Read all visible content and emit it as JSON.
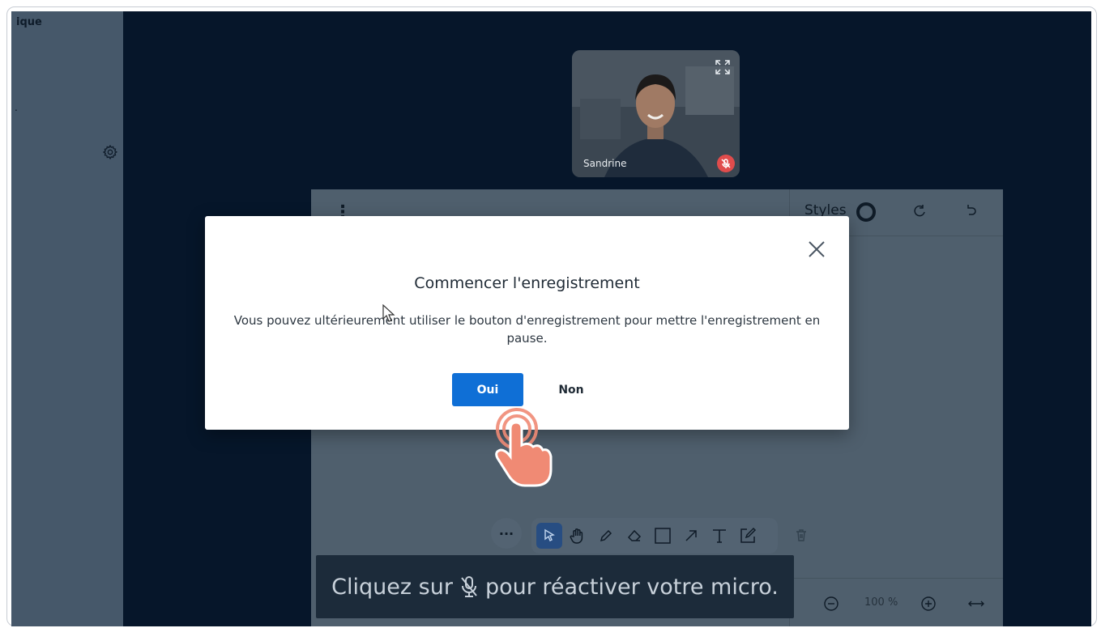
{
  "sidebar": {
    "top_text": "ique",
    "dot": "."
  },
  "video": {
    "participant_name": "Sandrine",
    "expand_icon": "expand-icon",
    "mute_icon": "mic-off-icon"
  },
  "board": {
    "styles_label": "Styles",
    "zoom_level": "100 %",
    "more_label": "···",
    "tools": [
      "select-icon",
      "hand-icon",
      "pencil-icon",
      "eraser-icon",
      "rectangle-icon",
      "arrow-icon",
      "text-icon",
      "note-icon"
    ]
  },
  "mic_notice": {
    "before": "Cliquez sur",
    "after": "pour réactiver votre micro."
  },
  "modal": {
    "title": "Commencer l'enregistrement",
    "body": "Vous pouvez ultérieurement utiliser le bouton d'enregistrement pour mettre l'enregistrement en pause.",
    "yes_label": "Oui",
    "no_label": "Non"
  },
  "colors": {
    "backdrop": "#06162a",
    "primary_button": "#0f6fd6",
    "tap_indicator": "#f08a74"
  }
}
